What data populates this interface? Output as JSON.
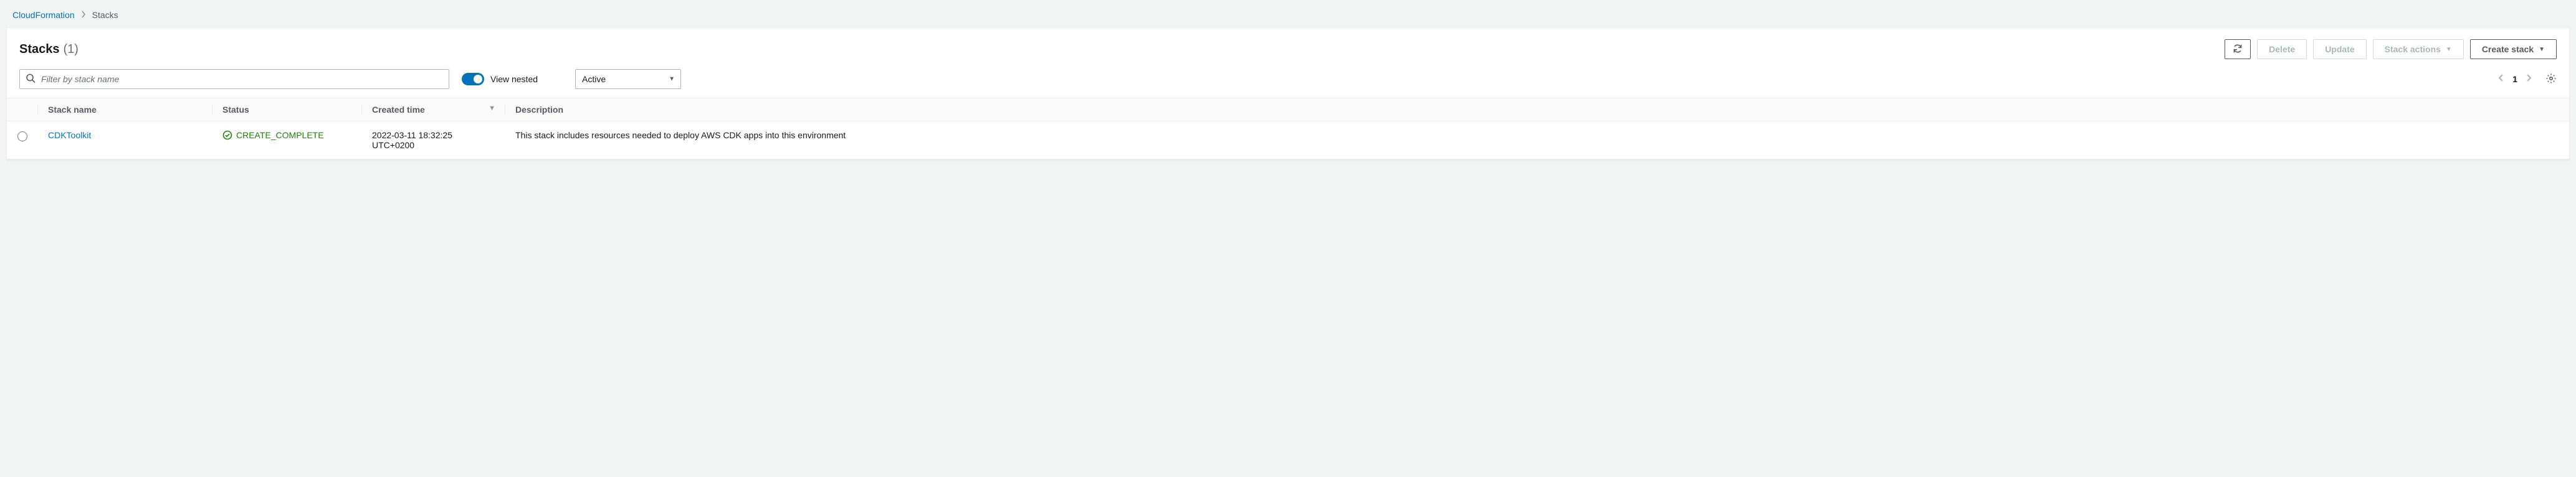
{
  "breadcrumb": {
    "root": "CloudFormation",
    "current": "Stacks"
  },
  "header": {
    "title": "Stacks",
    "count": "(1)",
    "refresh_label": "",
    "delete_label": "Delete",
    "update_label": "Update",
    "stack_actions_label": "Stack actions",
    "create_stack_label": "Create stack"
  },
  "filter": {
    "placeholder": "Filter by stack name",
    "view_nested_label": "View nested",
    "status_value": "Active"
  },
  "pagination": {
    "page": "1"
  },
  "columns": {
    "name": "Stack name",
    "status": "Status",
    "created": "Created time",
    "description": "Description"
  },
  "rows": [
    {
      "name": "CDKToolkit",
      "status": "CREATE_COMPLETE",
      "created": "2022-03-11 18:32:25 UTC+0200",
      "description": "This stack includes resources needed to deploy AWS CDK apps into this environment"
    }
  ]
}
